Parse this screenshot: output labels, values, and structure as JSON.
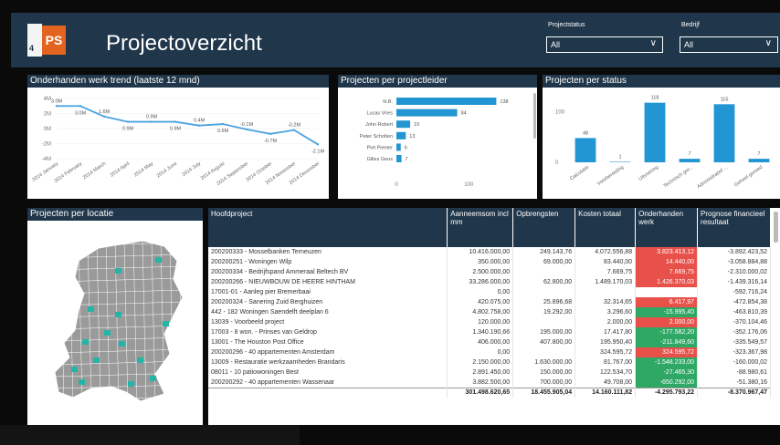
{
  "app": {
    "logo_digit": "4",
    "logo_letters": "PS",
    "title": "Projectoverzicht"
  },
  "filters": [
    {
      "label": "Projectstatus",
      "value": "All"
    },
    {
      "label": "Bedrijf",
      "value": "All"
    }
  ],
  "trend": {
    "title": "Onderhanden werk trend (laatste 12 mnd)",
    "yticks": [
      "4M",
      "2M",
      "0M",
      "-2M",
      "-4M"
    ],
    "months": [
      "2014 January",
      "2014 February",
      "2014 March",
      "2014 April",
      "2014 May",
      "2014 June",
      "2014 July",
      "2014 August",
      "2014 September",
      "2014 October",
      "2014 November",
      "2014 December"
    ],
    "labels": [
      "3.0M",
      "3.0M",
      "1.6M",
      "0.9M",
      "0.9M",
      "0.9M",
      "0.4M",
      "0.6M",
      "-0.1M",
      "-0.7M",
      "-0.2M",
      "-2.1M"
    ],
    "values": [
      3.0,
      3.0,
      1.6,
      0.9,
      0.9,
      0.9,
      0.4,
      0.6,
      -0.1,
      -0.7,
      -0.2,
      -2.1
    ],
    "line_color": "#4aa3df"
  },
  "leader": {
    "title": "Projecten per projectleider",
    "names": [
      "N.B.",
      "Lucas Vries",
      "John Robert",
      "Peter Scholten",
      "Piet Pienter",
      "Gilles Geus"
    ],
    "values": [
      138,
      84,
      19,
      13,
      6,
      7
    ],
    "labels": [
      "138",
      "84",
      "19",
      "13",
      "6",
      "7"
    ],
    "axis": [
      "0",
      "100"
    ],
    "bar_color": "#2196d3"
  },
  "status": {
    "title": "Projecten per status",
    "categories": [
      "Calculatie",
      "Voorbereiding",
      "Uitvoering",
      "Technisch ger...",
      "Administratief ...",
      "Geheel gereed"
    ],
    "values": [
      48,
      1,
      118,
      7,
      115,
      7
    ],
    "labels": [
      "48",
      "1",
      "118",
      "7",
      "115",
      "7"
    ],
    "yticks": [
      "100",
      "0"
    ],
    "bar_color": "#2196d3"
  },
  "location": {
    "title": "Projecten per locatie",
    "map_color": "#9a9a9a",
    "highlight_color": "#24b5a6"
  },
  "table": {
    "headers": [
      "Hoofdproject",
      "Aanneemsom incl mm",
      "Opbrengsten",
      "Kosten totaal",
      "Onderhanden werk",
      "Prognose financieel resultaat"
    ],
    "rows": [
      {
        "name": "200200333 - Mosselbanken Terneuzen",
        "a": "10.416.000,00",
        "o": "249.143,76",
        "k": "4.072.556,88",
        "w": "3.823.413,12",
        "p": "-3.892.423,52",
        "wc": "red"
      },
      {
        "name": "200200251 - Woningen Wilp",
        "a": "350.000,00",
        "o": "69.000,00",
        "k": "83.440,00",
        "w": "14.440,00",
        "p": "-3.058.884,88",
        "wc": "red"
      },
      {
        "name": "200200334 - Bedrijfspand Ammeraal Beltech BV",
        "a": "2.500.000,00",
        "o": "",
        "k": "7.669,75",
        "w": "7.669,75",
        "p": "-2.310.000,02",
        "wc": "red"
      },
      {
        "name": "200200266 - NIEUWBOUW DE HEERE HINTHAM",
        "a": "33.286.000,00",
        "o": "62.800,00",
        "k": "1.489.170,03",
        "w": "1.426.370,03",
        "p": "-1.439.316,14",
        "wc": "red"
      },
      {
        "name": "17001-01 - Aanleg pier Bremerbaai",
        "a": "0,00",
        "o": "",
        "k": "",
        "w": "",
        "p": "-592.716,24",
        "wc": ""
      },
      {
        "name": "200200324 - Sanering Zuid Berghuizen",
        "a": "420.075,00",
        "o": "25.896,68",
        "k": "32.314,65",
        "w": "6.417,97",
        "p": "-472.854,38",
        "wc": "red"
      },
      {
        "name": "442 - 182 Woningen Saendelft deelplan 6",
        "a": "4.802.758,00",
        "o": "19.292,00",
        "k": "3.296,60",
        "w": "-15.995,40",
        "p": "-463.810,39",
        "wc": "green"
      },
      {
        "name": "13039 - Voorbeeld project",
        "a": "120.000,00",
        "o": "",
        "k": "2.000,00",
        "w": "2.000,00",
        "p": "-370.104,46",
        "wc": "red"
      },
      {
        "name": "17003 - 8 won. - Prinses van Geldrop",
        "a": "1.340.190,66",
        "o": "195.000,00",
        "k": "17.417,80",
        "w": "-177.582,20",
        "p": "-352.176,06",
        "wc": "green"
      },
      {
        "name": "13001 - The Houston Post Office",
        "a": "406.000,00",
        "o": "407.800,00",
        "k": "195.950,40",
        "w": "-211.849,60",
        "p": "-335.549,57",
        "wc": "green"
      },
      {
        "name": "200200296 - 40 appartementen Amsterdam",
        "a": "0,00",
        "o": "",
        "k": "324.595,72",
        "w": "324.595,72",
        "p": "-323.367,98",
        "wc": "red"
      },
      {
        "name": "13009 - Restauratie werkzaamheden Brandaris",
        "a": "2.150.000,00",
        "o": "1.630.000,00",
        "k": "81.767,00",
        "w": "-1.548.233,00",
        "p": "-160.000,02",
        "wc": "green"
      },
      {
        "name": "08011 - 10 patiowoningen Best",
        "a": "2.891.450,00",
        "o": "150.000,00",
        "k": "122.534,70",
        "w": "-27.465,30",
        "p": "-88.980,61",
        "wc": "green"
      },
      {
        "name": "200200292 - 40 appartementen Wassenaar",
        "a": "3.882.500,00",
        "o": "700.000,00",
        "k": "49.708,00",
        "w": "-650.292,00",
        "p": "-51.380,16",
        "wc": "green"
      }
    ],
    "totals": {
      "name": "",
      "a": "301.498.620,65",
      "o": "18.455.905,04",
      "k": "14.160.111,82",
      "w": "-4.295.793,22",
      "p": "-8.370.967,47"
    },
    "red_color": "#e8504a",
    "green_color": "#2fa866"
  }
}
